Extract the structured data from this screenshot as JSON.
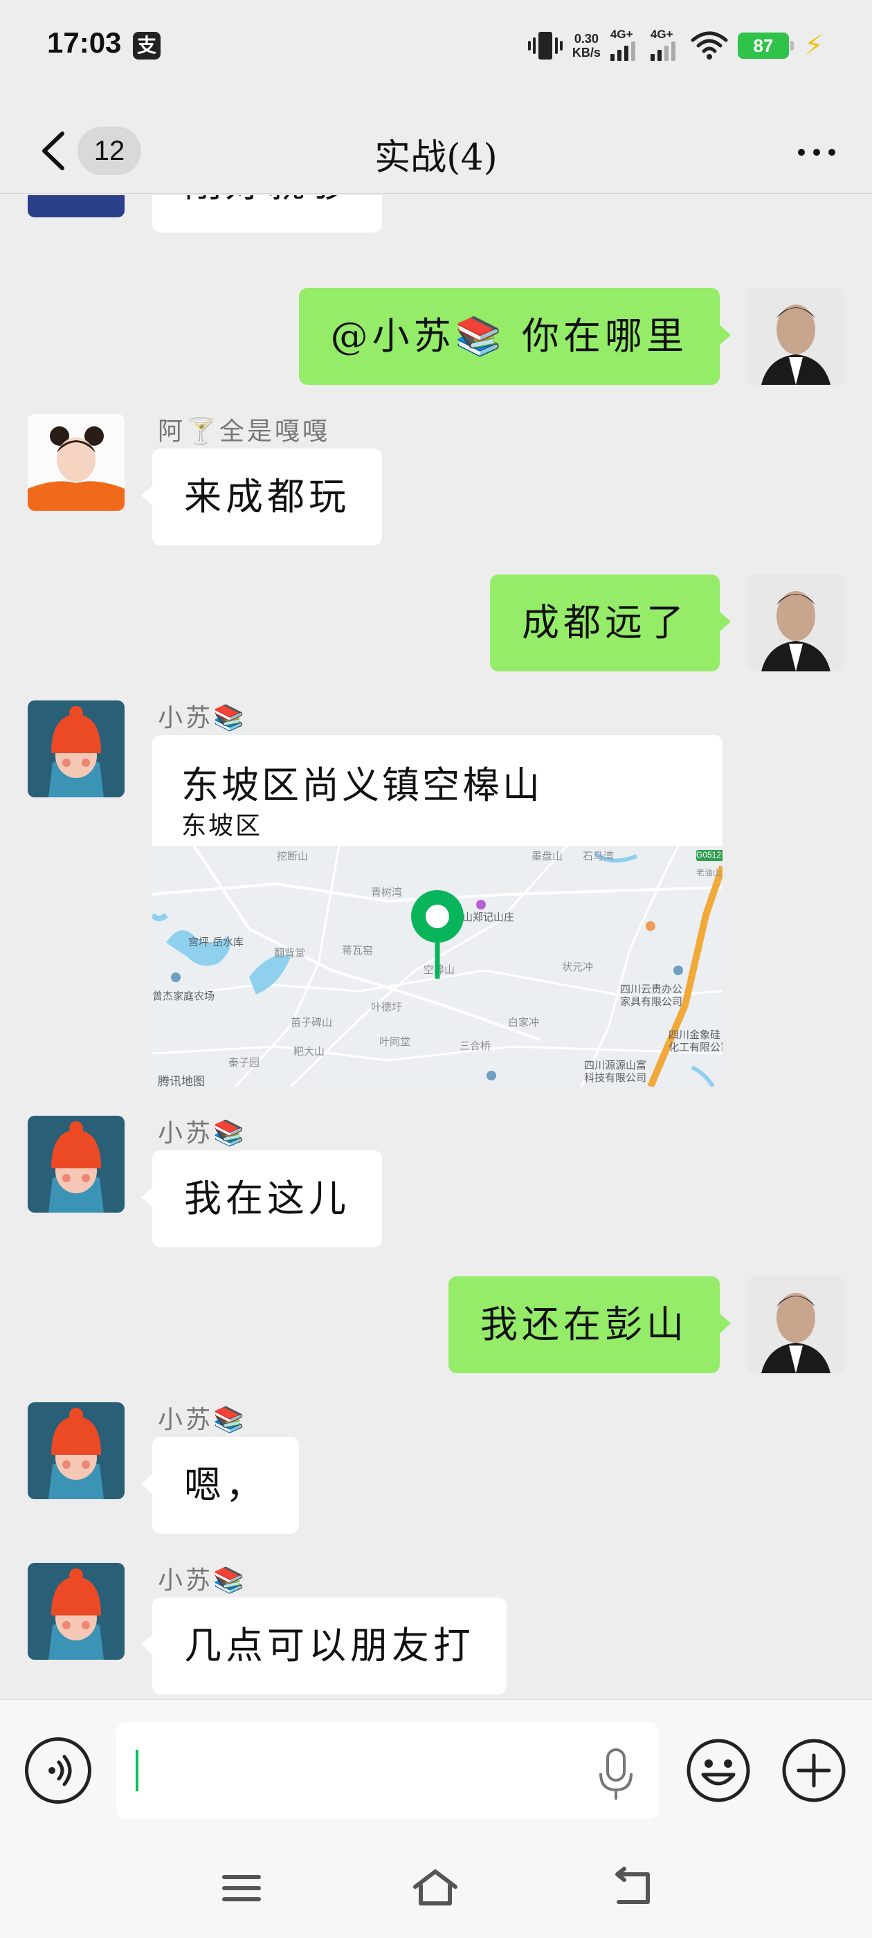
{
  "status_bar": {
    "time": "17:03",
    "alipay_glyph": "支",
    "net_speed_value": "0.30",
    "net_speed_unit": "KB/s",
    "sim1_label": "4G+",
    "sim2_label": "4G+",
    "battery": "87"
  },
  "header": {
    "unread_count": "12",
    "title": "实战(4)"
  },
  "messages": [
    {
      "sender": "",
      "text": "刚好就够",
      "direction": "in"
    },
    {
      "sender": "",
      "text": "@小苏📚 你在哪里",
      "direction": "out"
    },
    {
      "sender": "阿🍸全是嘎嘎",
      "text": "来成都玩",
      "direction": "in"
    },
    {
      "sender": "",
      "text": "成都远了",
      "direction": "out"
    },
    {
      "sender": "小苏📚",
      "type": "location",
      "title": "东坡区尚义镇空槔山",
      "subtitle": "东坡区"
    },
    {
      "sender": "小苏📚",
      "text": "我在这儿",
      "direction": "in"
    },
    {
      "sender": "",
      "text": "我还在彭山",
      "direction": "out"
    },
    {
      "sender": "小苏📚",
      "text": "嗯，",
      "direction": "in"
    },
    {
      "sender": "小苏📚",
      "text": "几点可以朋友打",
      "direction": "in"
    }
  ],
  "map_labels": {
    "l1": "挖断山",
    "l2": "墨盘山",
    "l3": "石马湾",
    "l4": "G0512",
    "l5": "老油山",
    "l6": "青树湾",
    "l7": "山郑记山庄",
    "l8": "宫坪·岳水库",
    "l9": "翻背堂",
    "l10": "蒋瓦窑",
    "l11": "空槔山",
    "l12": "状元冲",
    "l13": "四川云贵办公",
    "l14": "家具有限公司",
    "l15": "曾杰家庭农场",
    "l16": "叶德圩",
    "l17": "白家冲",
    "l18": "苗子碑山",
    "l19": "叶同堂",
    "l20": "三合桥",
    "l21": "四川金象硅",
    "l22": "化工有限公司",
    "l23": "粑大山",
    "l24": "秦子园",
    "l25": "四川源源山富",
    "l26": "科技有限公司",
    "l27": "腾讯地图"
  },
  "input": {
    "value": ""
  },
  "icons": [
    "voice-icon",
    "mic-icon",
    "emoji-icon",
    "plus-icon",
    "menu-icon",
    "home-icon",
    "back-nav-icon"
  ]
}
